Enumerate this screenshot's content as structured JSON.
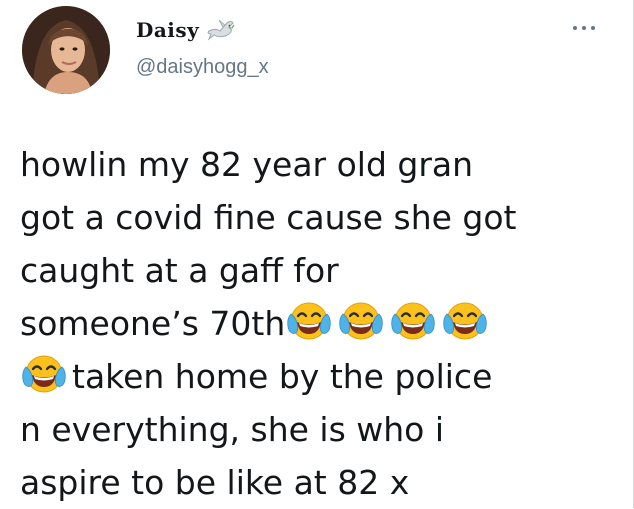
{
  "user": {
    "display_name": "Daisy",
    "handle": "@daisyhogg_x",
    "badge_icon": "dove-icon",
    "avatar": "profile-photo"
  },
  "menu": {
    "icon": "more-options-icon"
  },
  "tweet": {
    "lines": [
      {
        "text": "howlin my 82 year old gran"
      },
      {
        "text": "got a covid fine cause she got"
      },
      {
        "text": "caught at a gaff for"
      },
      {
        "text": "someone’s 70th",
        "emoji_after": 4,
        "emoji": "tears-of-joy-icon"
      },
      {
        "text": "taken home by the police",
        "emoji_before": 1,
        "emoji": "tears-of-joy-icon"
      },
      {
        "text": "n everything, she is who i"
      },
      {
        "text": "aspire to be like at 82 x"
      }
    ]
  },
  "colors": {
    "text": "#14171a",
    "secondary": "#657786",
    "emoji_face": "#fcc21b",
    "emoji_tears": "#4fb3e8"
  }
}
